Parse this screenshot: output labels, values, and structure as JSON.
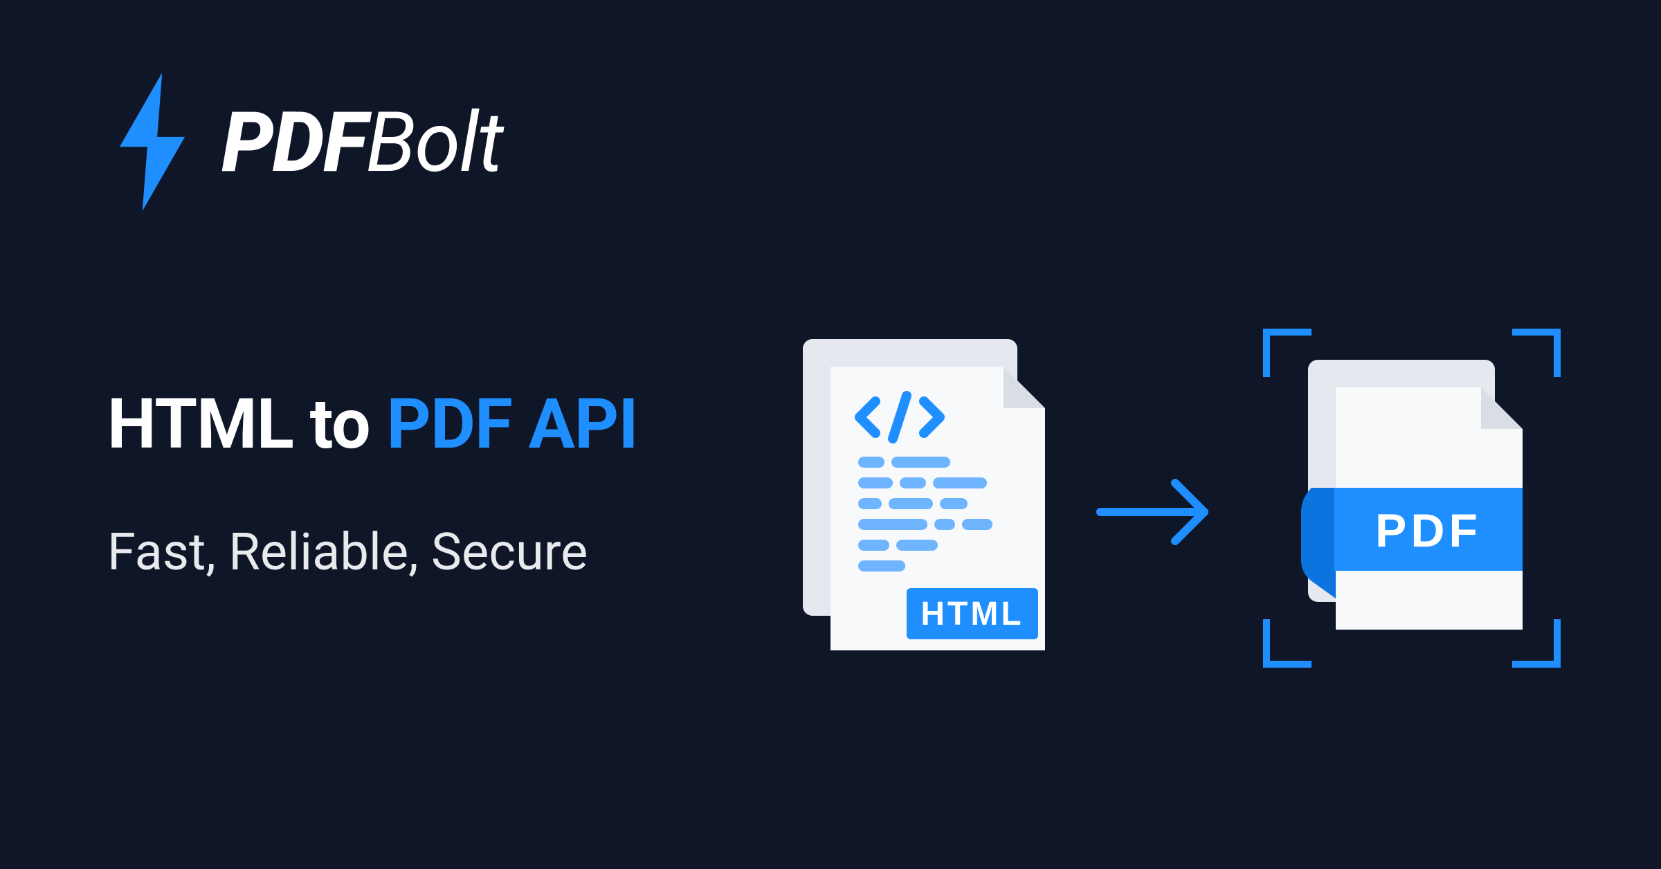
{
  "logo": {
    "bold_part": "PDF",
    "light_part": "Bolt"
  },
  "headline": {
    "part1": "HTML to ",
    "part2_accent": "PDF API"
  },
  "subline": "Fast, Reliable, Secure",
  "icons": {
    "html_badge": "HTML",
    "pdf_badge": "PDF"
  },
  "colors": {
    "background": "#0e1628",
    "accent_blue": "#1f8fff",
    "white": "#ffffff"
  }
}
